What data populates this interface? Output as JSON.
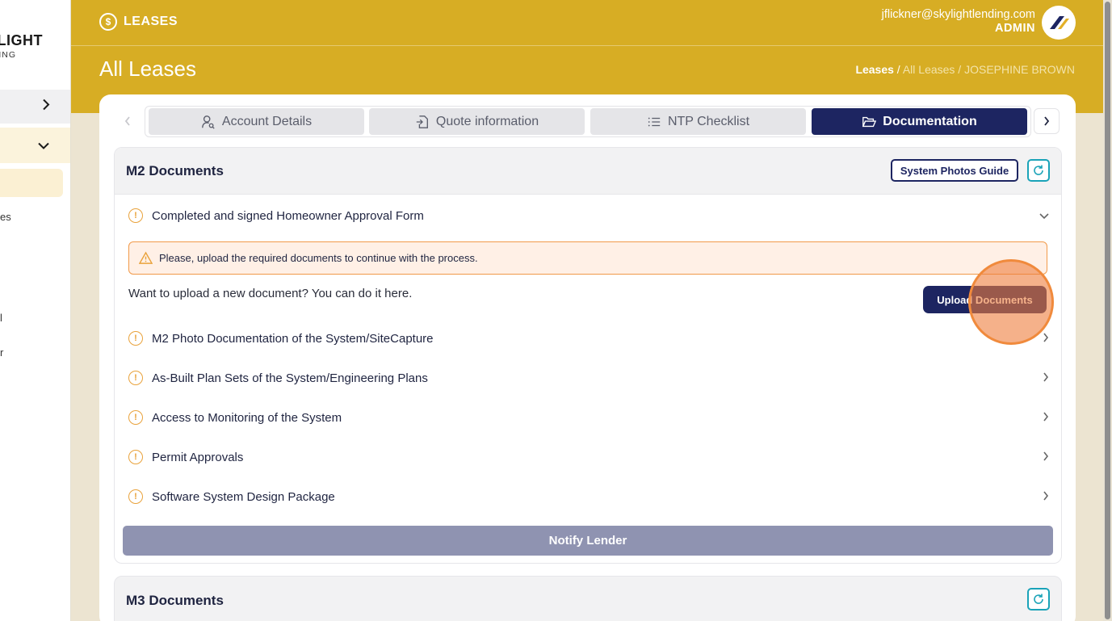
{
  "sidebar": {
    "logo_line1": "LIGHT",
    "logo_line2": "ING",
    "fragments": [
      "es",
      "l",
      "r"
    ],
    "icons": [
      "chevron-right-icon",
      "chevron-down-icon"
    ]
  },
  "header": {
    "nav_label": "LEASES",
    "nav_icon": "dollar-circle-icon",
    "user_email": "jflickner@skylightlending.com",
    "user_role": "ADMIN",
    "page_title": "All Leases",
    "breadcrumb": {
      "current": "Leases",
      "separator": " / ",
      "item2": "All Leases",
      "item3": "JOSEPHINE BROWN"
    }
  },
  "tabs": [
    {
      "label": "Account Details",
      "icon": "user-search-icon",
      "active": false
    },
    {
      "label": "Quote information",
      "icon": "file-import-icon",
      "active": false
    },
    {
      "label": "NTP Checklist",
      "icon": "list-icon",
      "active": false
    },
    {
      "label": "Documentation",
      "icon": "folder-open-icon",
      "active": true
    }
  ],
  "m2": {
    "title": "M2 Documents",
    "guide_button": "System Photos Guide",
    "expanded_item": "Completed and signed Homeowner Approval Form",
    "alert_text": "Please, upload the required documents to continue with the process.",
    "upload_prompt": "Want to upload a new document? You can do it here.",
    "upload_button": "Upload Documents",
    "items": [
      "M2 Photo Documentation of the System/SiteCapture",
      "As-Built Plan Sets of the System/Engineering Plans",
      "Access to Monitoring of the System",
      "Permit Approvals",
      "Software System Design Package"
    ],
    "notify_button": "Notify Lender"
  },
  "m3": {
    "title": "M3 Documents"
  },
  "colors": {
    "header": "#d7ad24",
    "primary": "#1d2561",
    "accent": "#1aa3b8",
    "warning": "#e9a23b",
    "alert_bg": "#fff0e6",
    "notify_disabled": "#8f93b1"
  }
}
